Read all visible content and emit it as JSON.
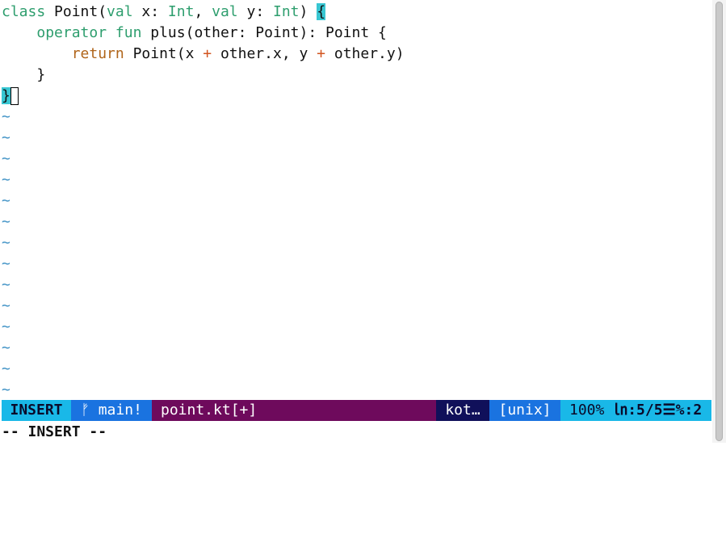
{
  "code": {
    "line1": {
      "kw_class": "class",
      "name": " Point(",
      "kw_val1": "val",
      "x_decl": " x: ",
      "type1": "Int",
      "comma": ", ",
      "kw_val2": "val",
      "y_decl": " y: ",
      "type2": "Int",
      "close": ") ",
      "brace": "{"
    },
    "line2": {
      "indent": "    ",
      "kw_operator": "operator",
      "sp": " ",
      "kw_fun": "fun",
      "sig": " plus(other: Point): Point {"
    },
    "line3": {
      "indent": "        ",
      "kw_return": "return",
      "a": " Point(x ",
      "plus1": "+",
      "b": " other.x, y ",
      "plus2": "+",
      "c": " other.y)"
    },
    "line4": "    }",
    "line5": "}",
    "filler": "~"
  },
  "statusline": {
    "mode": "INSERT",
    "branch": "ᚠ main!",
    "filename": "point.kt[+]",
    "filetype": "kot…",
    "fileformat": "[unix]",
    "percent": "100%",
    "position": "㏑:5/5☰%:2"
  },
  "cmdline": "-- INSERT --"
}
